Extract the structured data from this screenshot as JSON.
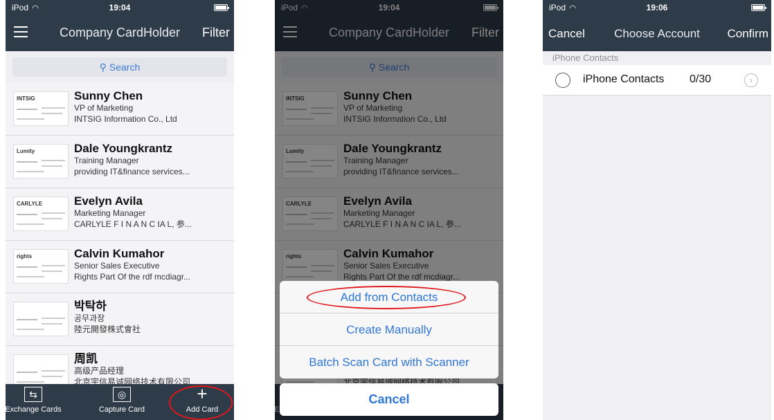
{
  "status": {
    "carrier": "iPod",
    "time1": "19:04",
    "time2": "19:04",
    "time3": "19:06"
  },
  "cardholder": {
    "title": "Company CardHolder",
    "filter": "Filter",
    "search_placeholder": "Search",
    "cards": [
      {
        "name": "Sunny Chen",
        "title": "VP of Marketing",
        "company": "INTSIG Information Co., Ltd",
        "logo": "INTSIG"
      },
      {
        "name": "Dale Youngkrantz",
        "title": "Training Manager",
        "company": "providing IT&finance services...",
        "logo": "Lumity"
      },
      {
        "name": "Evelyn Avila",
        "title": "Marketing Manager",
        "company": "CARLYLE F I N A N C IA L, 参...",
        "logo": "CARLYLE"
      },
      {
        "name": "Calvin Kumahor",
        "title": "Senior Sales Executive",
        "company": "Rights Part Of the rdf mcdiagr...",
        "logo": "rights"
      },
      {
        "name": "박탁하",
        "title": "공무과장",
        "company": "陸元開發株式會社",
        "logo": ""
      },
      {
        "name": "周凯",
        "title": "高级产品经理",
        "company": "北京宇信易诚网络技术有限公司",
        "logo": ""
      }
    ],
    "tabs": [
      "Exchange Cards",
      "Capture Card",
      "Add Card"
    ]
  },
  "sheet": {
    "options": [
      "Add from Contacts",
      "Create Manually",
      "Batch Scan Card with Scanner"
    ],
    "cancel": "Cancel"
  },
  "choose": {
    "cancel": "Cancel",
    "title": "Choose Account",
    "confirm": "Confirm",
    "section": "iPhone Contacts",
    "row_label": "iPhone Contacts",
    "row_count": "0/30"
  }
}
